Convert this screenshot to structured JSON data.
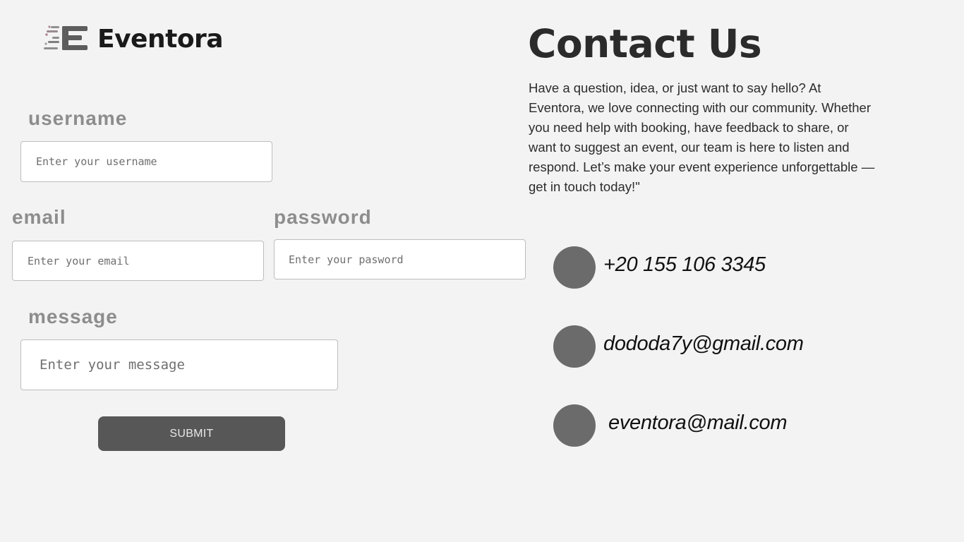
{
  "brand": {
    "name": "Eventora",
    "logo_icon": "speed-e-logo-icon"
  },
  "form": {
    "username_label": "username",
    "username_placeholder": "Enter your username",
    "email_label": "email",
    "email_placeholder": "Enter your email",
    "password_label": "password",
    "password_placeholder": "Enter your pasword",
    "message_label": "message",
    "message_placeholder": "Enter your message",
    "submit_label": "SUBMIT"
  },
  "contact": {
    "title": "Contact Us",
    "intro": "Have a question, idea, or just want to say hello? At Eventora, we love connecting with our community. Whether you need help with booking, have feedback to share, or want to suggest an event, our team is here to listen and respond. Let’s make your event experience unforgettable — get in touch today!\"",
    "items": [
      {
        "icon": "phone-icon",
        "text": "+20 155 106 3345"
      },
      {
        "icon": "email-icon",
        "text": "dododa7y@gmail.com"
      },
      {
        "icon": "email-icon",
        "text": "eventora@mail.com"
      }
    ]
  },
  "colors": {
    "background": "#f3f3f3",
    "label": "#8d8d8d",
    "button": "#575757",
    "icon_circle": "#6b6b6b",
    "text_dark": "#2b2b2b"
  }
}
